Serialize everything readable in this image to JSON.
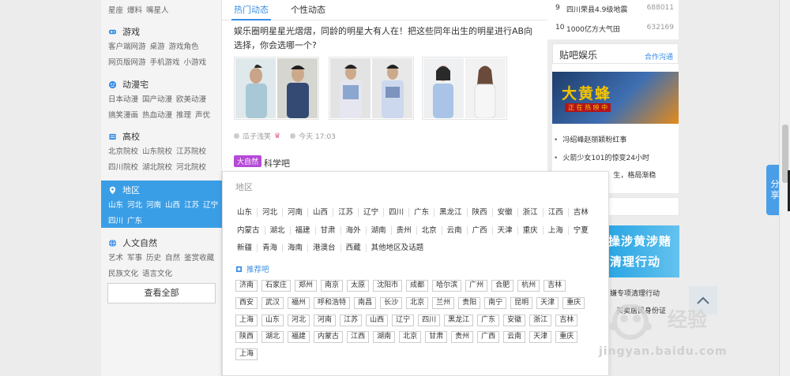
{
  "sidebar": {
    "top_links": [
      "星座",
      "爆料",
      "嘴星人"
    ],
    "categories": [
      {
        "name": "游戏",
        "icon": "gamepad-icon",
        "rows": [
          [
            "客户端网游",
            "桌游",
            "游戏角色"
          ],
          [
            "网页版网游",
            "手机游戏",
            "小游戏"
          ]
        ]
      },
      {
        "name": "动漫宅",
        "icon": "anime-icon",
        "rows": [
          [
            "日本动漫",
            "国产动漫",
            "欧美动漫"
          ],
          [
            "搞笑漫画",
            "热血动漫",
            "推理",
            "声优"
          ]
        ]
      },
      {
        "name": "高校",
        "icon": "school-icon",
        "rows": [
          [
            "北京院校",
            "山东院校",
            "江苏院校"
          ],
          [
            "四川院校",
            "湖北院校",
            "河北院校"
          ]
        ]
      },
      {
        "name": "地区",
        "icon": "location-pin-icon",
        "rows": [
          [
            "山东",
            "河北",
            "河南",
            "山西",
            "江苏",
            "辽宁"
          ],
          [
            "四川",
            "广东"
          ]
        ]
      },
      {
        "name": "人文自然",
        "icon": "globe-icon",
        "rows": [
          [
            "艺术",
            "军事",
            "历史",
            "自然",
            "鉴赏收藏"
          ],
          [
            "民族文化",
            "语言文化"
          ]
        ]
      }
    ],
    "view_all": "查看全部"
  },
  "main": {
    "tabs": [
      "热门动态",
      "个性动态"
    ],
    "post_title": "娱乐圈明星星光熠熠，同龄的明星大有人在！把这些同年出生的明星进行AB向选择，你会选哪一个?",
    "author": "瓜子浅笑",
    "time": "今天 17:03",
    "badge": "大自然",
    "forum": "科学吧"
  },
  "popup": {
    "title": "地区",
    "region_rows": [
      [
        "山东",
        "河北",
        "河南",
        "山西",
        "江苏",
        "辽宁",
        "四川",
        "广东",
        "黑龙江",
        "陕西",
        "安徽",
        "浙江",
        "江西",
        "吉林"
      ],
      [
        "内蒙古",
        "湖北",
        "福建",
        "甘肃",
        "海外",
        "湖南",
        "贵州",
        "北京",
        "云南",
        "广西",
        "天津",
        "重庆",
        "上海",
        "宁夏"
      ],
      [
        "新疆",
        "青海",
        "海南",
        "港澳台",
        "西藏",
        "其他地区及话题"
      ]
    ],
    "recommend_title": "推荐吧",
    "recommend_rows": [
      [
        "济南",
        "石家庄",
        "郑州",
        "南京",
        "太原",
        "沈阳市",
        "成都",
        "哈尔滨",
        "广州",
        "合肥",
        "杭州",
        "吉林"
      ],
      [
        "西安",
        "武汉",
        "福州",
        "呼和浩特",
        "南昌",
        "长沙",
        "北京",
        "兰州",
        "贵阳",
        "南宁",
        "昆明",
        "天津",
        "重庆"
      ],
      [
        "上海",
        "山东",
        "河北",
        "河南",
        "江苏",
        "山西",
        "辽宁",
        "四川",
        "黑龙江",
        "广东",
        "安徽",
        "浙江",
        "吉林"
      ],
      [
        "陕西",
        "湖北",
        "福建",
        "内蒙古",
        "江西",
        "湖南",
        "北京",
        "甘肃",
        "贵州",
        "广西",
        "云南",
        "天津",
        "重庆"
      ],
      [
        "上海"
      ]
    ]
  },
  "right": {
    "ranking": [
      {
        "rank": "9",
        "title": "四川荣县4.9级地震",
        "count": "688011"
      },
      {
        "rank": "10",
        "title": "1000亿方大气田",
        "count": "632169"
      }
    ],
    "ent_title": "贴吧娱乐",
    "ent_link": "合作沟通",
    "banner1_big": "大黄蜂",
    "banner1_sub": "正 在 热 映 中",
    "news": [
      "冯绍峰赵丽颖粉红事",
      "火箭少女101的惊变24小时",
      "生，格局渐稳"
    ],
    "banner2_l1": "操涉黄涉赌",
    "banner2_l2": "清理行动",
    "news2": [
      "嫌专项清理行动",
      "买卖居民身份证"
    ]
  },
  "share_label": "分享",
  "watermark": {
    "brand": "经验",
    "url": "jingyan.baidu.com"
  }
}
